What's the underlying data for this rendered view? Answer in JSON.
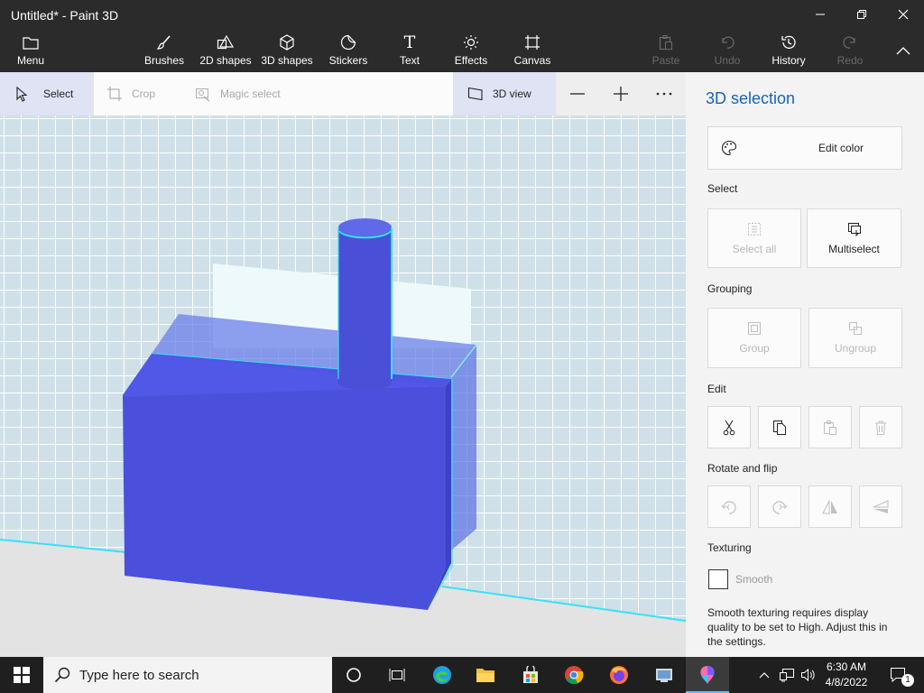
{
  "window": {
    "title": "Untitled* - Paint 3D"
  },
  "toolbar": {
    "menu": "Menu",
    "brushes": "Brushes",
    "shapes2d": "2D shapes",
    "shapes3d": "3D shapes",
    "stickers": "Stickers",
    "text": "Text",
    "effects": "Effects",
    "canvas": "Canvas",
    "paste": "Paste",
    "undo": "Undo",
    "history": "History",
    "redo": "Redo"
  },
  "subtoolbar": {
    "select": "Select",
    "crop": "Crop",
    "magic_select": "Magic select",
    "view3d": "3D view"
  },
  "panel": {
    "title": "3D selection",
    "edit_color": "Edit color",
    "select_heading": "Select",
    "select_all": "Select all",
    "multiselect": "Multiselect",
    "grouping_heading": "Grouping",
    "group": "Group",
    "ungroup": "Ungroup",
    "edit_heading": "Edit",
    "rotate_heading": "Rotate and flip",
    "texturing_heading": "Texturing",
    "smooth": "Smooth",
    "smooth_note": "Smooth texturing requires display quality to be set to High. Adjust this in the settings."
  },
  "taskbar": {
    "search_placeholder": "Type here to search",
    "time": "6:30 AM",
    "date": "4/8/2022",
    "notification_count": "1"
  },
  "colors": {
    "shape_front": "#4b50dc",
    "shape_top": "#4f55e3",
    "shape_side": "#3d41c8",
    "accent": "#1a62b8",
    "selection_glow": "#35e2f5"
  },
  "icons": [
    "folder-icon",
    "brush-icon",
    "shapes-2d-icon",
    "cube-icon",
    "sticker-icon",
    "text-icon",
    "effects-icon",
    "canvas-icon",
    "paste-icon",
    "undo-icon",
    "history-icon",
    "redo-icon",
    "cursor-icon",
    "crop-icon",
    "magic-select-icon",
    "view3d-icon",
    "minus-icon",
    "plus-icon",
    "more-icon",
    "palette-icon",
    "select-all-icon",
    "multiselect-icon",
    "group-icon",
    "ungroup-icon",
    "cut-icon",
    "copy-icon",
    "paste-small-icon",
    "delete-icon",
    "rotate-left-icon",
    "rotate-right-icon",
    "flip-horizontal-icon",
    "flip-vertical-icon"
  ]
}
